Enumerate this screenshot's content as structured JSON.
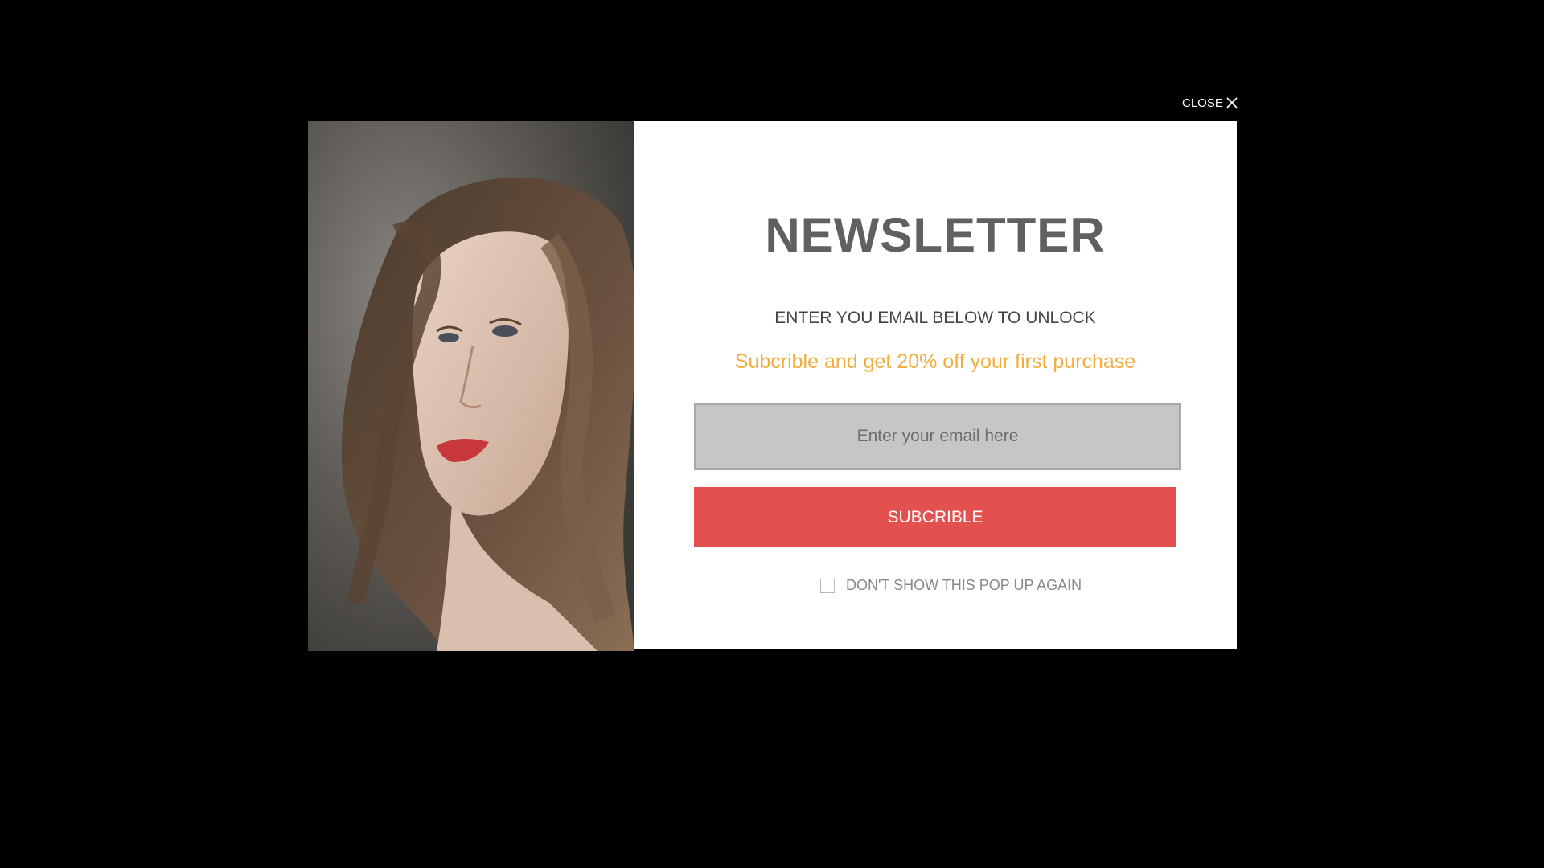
{
  "close": {
    "label": "CLOSE"
  },
  "icons": {
    "close": "close-icon",
    "photo": "portrait-photo"
  },
  "newsletter": {
    "title": "NEWSLETTER",
    "subtitle": "ENTER YOU EMAIL BELOW TO UNLOCK",
    "promo": "Subcrible and get 20% off your first purchase",
    "email_placeholder": "Enter your email here",
    "email_value": "",
    "subscribe_label": "SUBCRIBLE",
    "dont_show_label": "DON'T SHOW THIS POP UP AGAIN",
    "dont_show_checked": false
  },
  "colors": {
    "overlay": "#000000",
    "title": "#606060",
    "promo": "#f0ad3e",
    "button": "#e2514f",
    "input_bg": "#c6c6c6"
  }
}
